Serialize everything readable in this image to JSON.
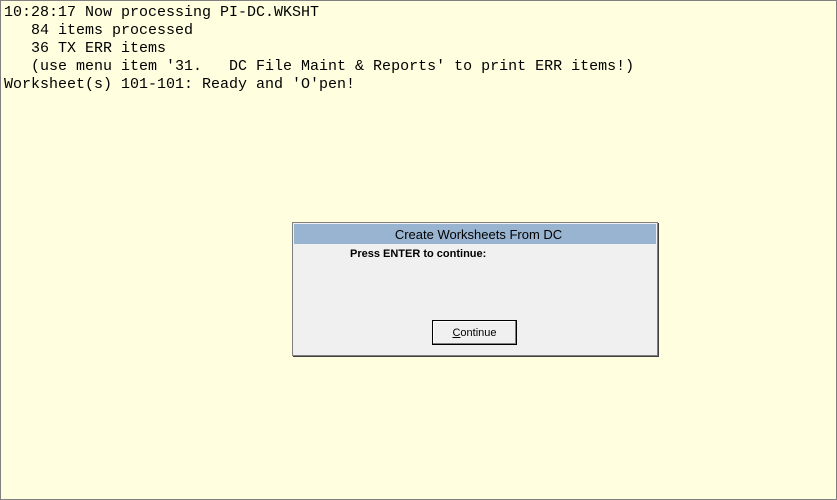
{
  "console": {
    "lines": [
      "10:28:17 Now processing PI-DC.WKSHT",
      "   84 items processed",
      "   36 TX ERR items",
      "   (use menu item '31.   DC File Maint & Reports' to print ERR items!)",
      "Worksheet(s) 101-101: Ready and 'O'pen!"
    ]
  },
  "dialog": {
    "title": "Create Worksheets From DC",
    "message": "Press ENTER to continue:",
    "button": {
      "accel": "C",
      "rest": "ontinue"
    }
  },
  "colors": {
    "background": "#ffffe0",
    "titlebar": "#99b4d1",
    "dialog": "#f0f0f0"
  }
}
